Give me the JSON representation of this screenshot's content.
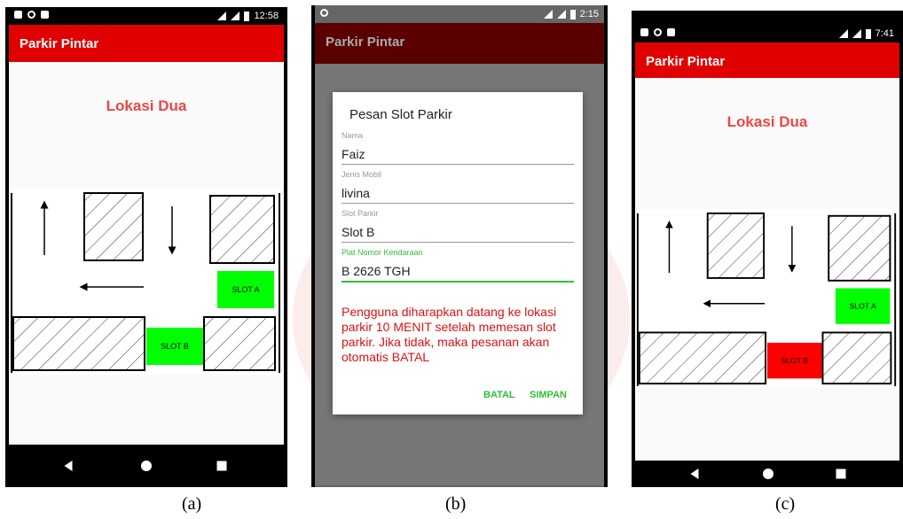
{
  "app_title": "Parkir Pintar",
  "location_title": "Lokasi Dua",
  "screen_a": {
    "time": "12:58",
    "slot_a": "SLOT A",
    "slot_b": "SLOT B",
    "caption": "(a)"
  },
  "screen_b": {
    "time": "2:15",
    "caption": "(b)",
    "dialog": {
      "title": "Pesan Slot Parkir",
      "fields": [
        {
          "label": "Nama",
          "value": "Faiz"
        },
        {
          "label": "Jenis Mobil",
          "value": "livina"
        },
        {
          "label": "Slot Parkir",
          "value": "Slot B"
        },
        {
          "label": "Plat Nomor Kendaraan",
          "value": "B 2626 TGH"
        }
      ],
      "message": "Pengguna diharapkan datang ke lokasi parkir 10 MENIT setelah memesan slot parkir. Jika tidak, maka pesanan akan otomatis BATAL",
      "cancel": "BATAL",
      "save": "SIMPAN"
    }
  },
  "screen_c": {
    "time": "7:41",
    "slot_a": "SLOT A",
    "slot_b": "SLOT B",
    "caption": "(c)"
  },
  "colors": {
    "appbar": "#e00000",
    "appbar_dim": "#5a0000",
    "free": "#00ff00",
    "booked": "#ff0000",
    "title": "#f04545",
    "accent": "#2fbf3a"
  }
}
